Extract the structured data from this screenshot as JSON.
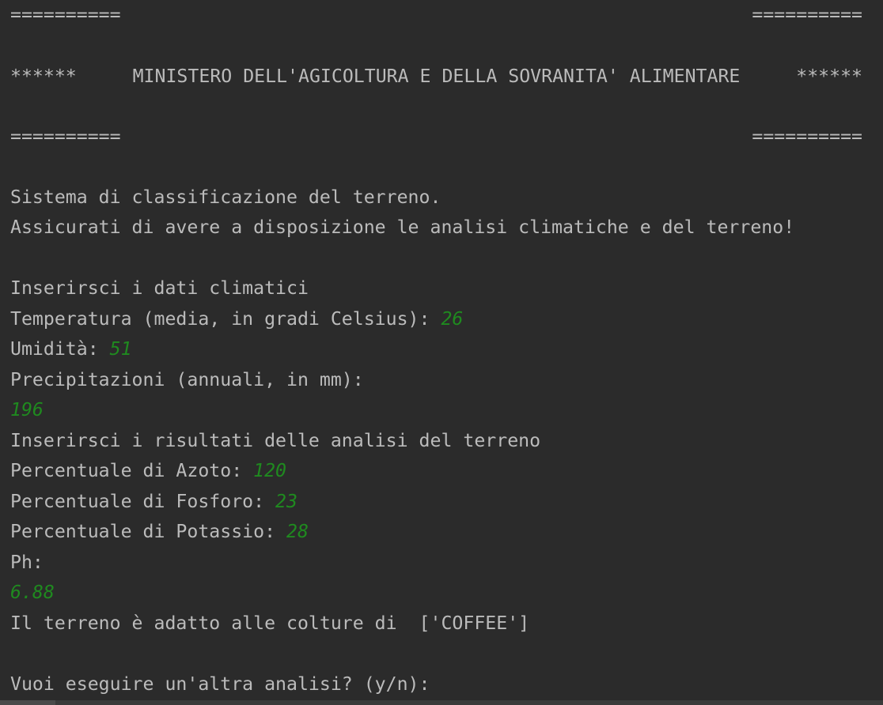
{
  "banner": {
    "rule_left": "==========",
    "rule_right": "==========",
    "stars_left": "******",
    "stars_right": "******",
    "title": "MINISTERO DELL'AGICOLTURA E DELLA SOVRANITA' ALIMENTARE"
  },
  "intro": {
    "line1": "Sistema di classificazione del terreno.",
    "line2": "Assicurati di avere a disposizione le analisi climatiche e del terreno!"
  },
  "climate": {
    "heading": "Inserirsci i dati climatici",
    "temperature_prompt": "Temperatura (media, in gradi Celsius): ",
    "temperature_value": "26",
    "humidity_prompt": "Umidità: ",
    "humidity_value": "51",
    "rain_prompt": "Precipitazioni (annuali, in mm):",
    "rain_value": "196"
  },
  "soil": {
    "heading": "Inserirsci i risultati delle analisi del terreno",
    "nitrogen_prompt": "Percentuale di Azoto: ",
    "nitrogen_value": "120",
    "phosphorus_prompt": "Percentuale di Fosforo: ",
    "phosphorus_value": "23",
    "potassium_prompt": "Percentuale di Potassio: ",
    "potassium_value": "28",
    "ph_prompt": "Ph:",
    "ph_value": "6.88"
  },
  "result": {
    "text": "Il terreno è adatto alle colture di  ['COFFEE']"
  },
  "again": {
    "prompt": "Vuoi eseguire un'altra analisi? (y/n):"
  },
  "colors": {
    "background": "#2b2b2b",
    "text": "#bbbbbb",
    "input": "#1f8a1f"
  }
}
